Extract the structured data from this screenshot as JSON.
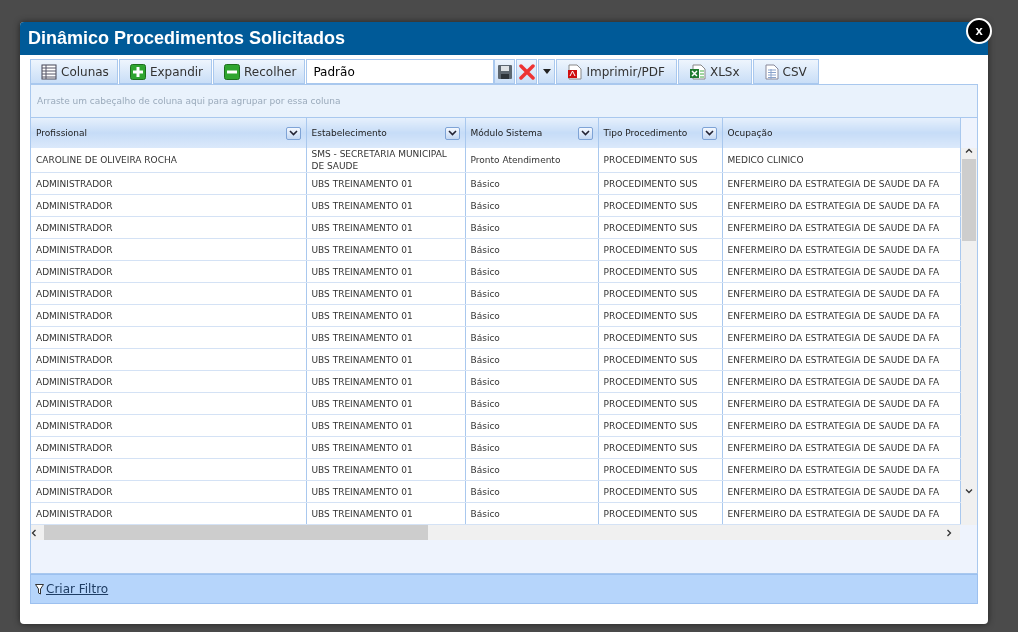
{
  "dialog": {
    "title": "Dinâmico Procedimentos Solicitados",
    "close": "x"
  },
  "toolbar": {
    "buttons": [
      {
        "label": "Colunas"
      },
      {
        "label": "Expandir"
      },
      {
        "label": "Recolher"
      }
    ],
    "layout_field": {
      "value": "Padrão"
    },
    "export_buttons": [
      {
        "label": "Imprimir/PDF"
      },
      {
        "label": "XLSx"
      },
      {
        "label": "CSV"
      }
    ]
  },
  "group_panel": {
    "hint": "Arraste um cabeçalho de coluna aqui para agrupar por essa coluna"
  },
  "table": {
    "columns": [
      {
        "label": "Profissional",
        "filter": true
      },
      {
        "label": "Estabelecimento",
        "filter": true
      },
      {
        "label": "Módulo Sistema",
        "filter": true
      },
      {
        "label": "Tipo Procedimento",
        "filter": true
      },
      {
        "label": "Ocupação",
        "filter": false
      }
    ],
    "rows": [
      [
        "CAROLINE DE OLIVEIRA ROCHA",
        "SMS - SECRETARIA MUNICIPAL DE SAUDE",
        "Pronto Atendimento",
        "PROCEDIMENTO SUS",
        "MEDICO CLINICO"
      ],
      [
        "ADMINISTRADOR",
        "UBS TREINAMENTO 01",
        "Básico",
        "PROCEDIMENTO SUS",
        "ENFERMEIRO DA ESTRATEGIA DE SAUDE DA FA"
      ],
      [
        "ADMINISTRADOR",
        "UBS TREINAMENTO 01",
        "Básico",
        "PROCEDIMENTO SUS",
        "ENFERMEIRO DA ESTRATEGIA DE SAUDE DA FA"
      ],
      [
        "ADMINISTRADOR",
        "UBS TREINAMENTO 01",
        "Básico",
        "PROCEDIMENTO SUS",
        "ENFERMEIRO DA ESTRATEGIA DE SAUDE DA FA"
      ],
      [
        "ADMINISTRADOR",
        "UBS TREINAMENTO 01",
        "Básico",
        "PROCEDIMENTO SUS",
        "ENFERMEIRO DA ESTRATEGIA DE SAUDE DA FA"
      ],
      [
        "ADMINISTRADOR",
        "UBS TREINAMENTO 01",
        "Básico",
        "PROCEDIMENTO SUS",
        "ENFERMEIRO DA ESTRATEGIA DE SAUDE DA FA"
      ],
      [
        "ADMINISTRADOR",
        "UBS TREINAMENTO 01",
        "Básico",
        "PROCEDIMENTO SUS",
        "ENFERMEIRO DA ESTRATEGIA DE SAUDE DA FA"
      ],
      [
        "ADMINISTRADOR",
        "UBS TREINAMENTO 01",
        "Básico",
        "PROCEDIMENTO SUS",
        "ENFERMEIRO DA ESTRATEGIA DE SAUDE DA FA"
      ],
      [
        "ADMINISTRADOR",
        "UBS TREINAMENTO 01",
        "Básico",
        "PROCEDIMENTO SUS",
        "ENFERMEIRO DA ESTRATEGIA DE SAUDE DA FA"
      ],
      [
        "ADMINISTRADOR",
        "UBS TREINAMENTO 01",
        "Básico",
        "PROCEDIMENTO SUS",
        "ENFERMEIRO DA ESTRATEGIA DE SAUDE DA FA"
      ],
      [
        "ADMINISTRADOR",
        "UBS TREINAMENTO 01",
        "Básico",
        "PROCEDIMENTO SUS",
        "ENFERMEIRO DA ESTRATEGIA DE SAUDE DA FA"
      ],
      [
        "ADMINISTRADOR",
        "UBS TREINAMENTO 01",
        "Básico",
        "PROCEDIMENTO SUS",
        "ENFERMEIRO DA ESTRATEGIA DE SAUDE DA FA"
      ],
      [
        "ADMINISTRADOR",
        "UBS TREINAMENTO 01",
        "Básico",
        "PROCEDIMENTO SUS",
        "ENFERMEIRO DA ESTRATEGIA DE SAUDE DA FA"
      ],
      [
        "ADMINISTRADOR",
        "UBS TREINAMENTO 01",
        "Básico",
        "PROCEDIMENTO SUS",
        "ENFERMEIRO DA ESTRATEGIA DE SAUDE DA FA"
      ],
      [
        "ADMINISTRADOR",
        "UBS TREINAMENTO 01",
        "Básico",
        "PROCEDIMENTO SUS",
        "ENFERMEIRO DA ESTRATEGIA DE SAUDE DA FA"
      ],
      [
        "ADMINISTRADOR",
        "UBS TREINAMENTO 01",
        "Básico",
        "PROCEDIMENTO SUS",
        "ENFERMEIRO DA ESTRATEGIA DE SAUDE DA FA"
      ],
      [
        "ADMINISTRADOR",
        "UBS TREINAMENTO 01",
        "Básico",
        "PROCEDIMENTO SUS",
        "ENFERMEIRO DA ESTRATEGIA DE SAUDE DA FA"
      ]
    ]
  },
  "footer": {
    "link": "Criar Filtro"
  }
}
